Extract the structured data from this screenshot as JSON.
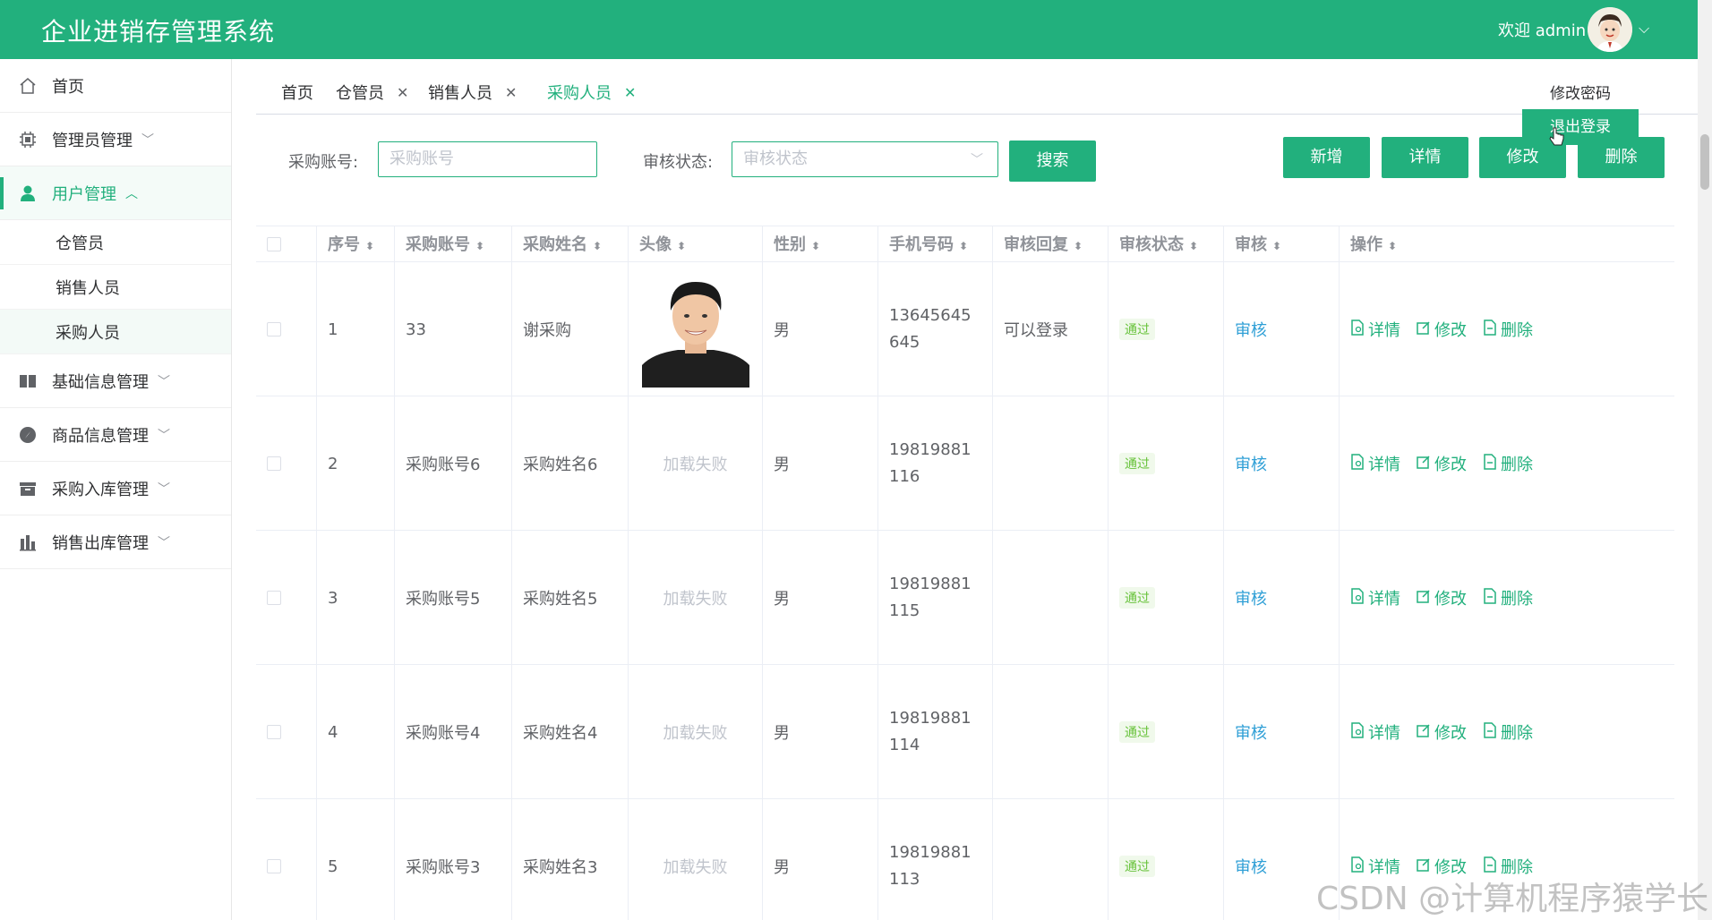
{
  "header": {
    "title": "企业进销存管理系统",
    "welcome": "欢迎 admin",
    "dropdown": {
      "change_password": "修改密码",
      "logout": "退出登录"
    }
  },
  "sidebar": {
    "home": "首页",
    "admin_mgmt": "管理员管理",
    "user_mgmt": "用户管理",
    "user_sub": [
      "仓管员",
      "销售人员",
      "采购人员"
    ],
    "base_info": "基础信息管理",
    "goods_info": "商品信息管理",
    "purchase_in": "采购入库管理",
    "sales_out": "销售出库管理"
  },
  "tabs": [
    "首页",
    "仓管员",
    "销售人员",
    "采购人员"
  ],
  "filters": {
    "account_label": "采购账号:",
    "account_placeholder": "采购账号",
    "status_label": "审核状态:",
    "status_placeholder": "审核状态",
    "search_button": "搜索"
  },
  "actions": {
    "add": "新增",
    "detail": "详情",
    "edit": "修改",
    "delete": "删除"
  },
  "table": {
    "headers": [
      "序号",
      "采购账号",
      "采购姓名",
      "头像",
      "性别",
      "手机号码",
      "审核回复",
      "审核状态",
      "审核",
      "操作"
    ],
    "rows": [
      {
        "index": "1",
        "account": "33",
        "name": "谢采购",
        "avatar": "",
        "gender": "男",
        "phone": "13645645645",
        "reply": "可以登录",
        "status": "通过",
        "audit": "审核"
      },
      {
        "index": "2",
        "account": "采购账号6",
        "name": "采购姓名6",
        "avatar": "加载失败",
        "gender": "男",
        "phone": "19819881116",
        "reply": "",
        "status": "通过",
        "audit": "审核"
      },
      {
        "index": "3",
        "account": "采购账号5",
        "name": "采购姓名5",
        "avatar": "加载失败",
        "gender": "男",
        "phone": "19819881115",
        "reply": "",
        "status": "通过",
        "audit": "审核"
      },
      {
        "index": "4",
        "account": "采购账号4",
        "name": "采购姓名4",
        "avatar": "加载失败",
        "gender": "男",
        "phone": "19819881114",
        "reply": "",
        "status": "通过",
        "audit": "审核"
      },
      {
        "index": "5",
        "account": "采购账号3",
        "name": "采购姓名3",
        "avatar": "加载失败",
        "gender": "男",
        "phone": "19819881113",
        "reply": "",
        "status": "通过",
        "audit": "审核"
      }
    ],
    "row_ops": {
      "detail": "详情",
      "edit": "修改",
      "delete": "删除"
    }
  },
  "watermark": "CSDN @计算机程序猿学长",
  "colors": {
    "brand": "#22b07d",
    "link": "#2f9fd6",
    "success": "#67c23a"
  }
}
